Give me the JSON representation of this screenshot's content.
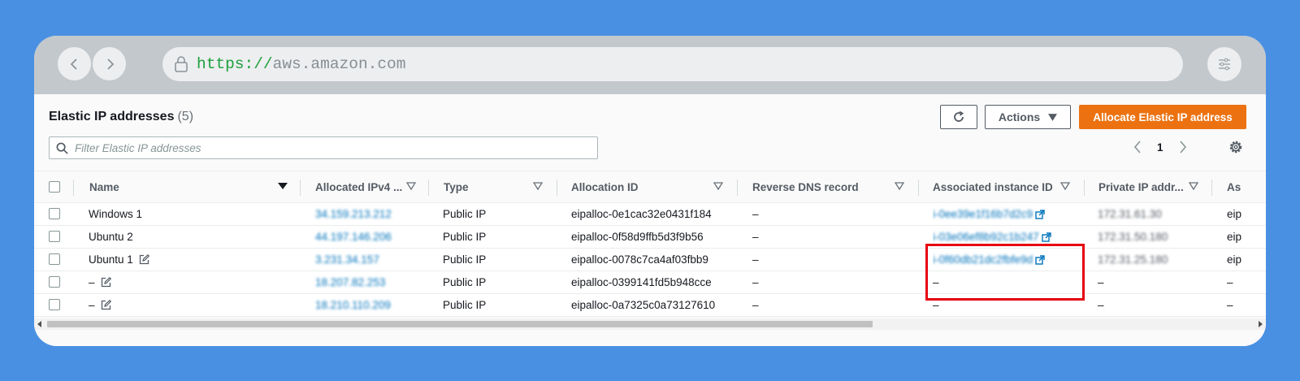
{
  "browser": {
    "url_scheme": "https://",
    "url_host": "aws.amazon.com"
  },
  "panel": {
    "title": "Elastic IP addresses",
    "count": "(5)",
    "actions_label": "Actions",
    "allocate_label": "Allocate Elastic IP address",
    "filter_placeholder": "Filter Elastic IP addresses",
    "current_page": "1"
  },
  "table": {
    "columns": [
      "Name",
      "Allocated IPv4 ...",
      "Type",
      "Allocation ID",
      "Reverse DNS record",
      "Associated instance ID",
      "Private IP addr...",
      "As"
    ],
    "rows": [
      {
        "name": "Windows 1",
        "ipv4": "34.159.213.212",
        "type": "Public IP",
        "allocation_id": "eipalloc-0e1cac32e0431f184",
        "reverse_dns": "–",
        "instance_id": "i-0ee39e1f16b7d2c9",
        "private_ip": "172.31.61.30",
        "assoc": "eip"
      },
      {
        "name": "Ubuntu 2",
        "ipv4": "44.197.146.206",
        "type": "Public IP",
        "allocation_id": "eipalloc-0f58d9ffb5d3f9b56",
        "reverse_dns": "–",
        "instance_id": "i-03e06ef8b92c1b247",
        "private_ip": "172.31.50.180",
        "assoc": "eip"
      },
      {
        "name": "Ubuntu 1",
        "ipv4": "3.231.34.157",
        "type": "Public IP",
        "allocation_id": "eipalloc-0078c7ca4af03fbb9",
        "reverse_dns": "–",
        "instance_id": "i-0f60db21dc2fbfe9d",
        "private_ip": "172.31.25.180",
        "assoc": "eip"
      },
      {
        "name": "–",
        "ipv4": "18.207.82.253",
        "type": "Public IP",
        "allocation_id": "eipalloc-0399141fd5b948cce",
        "reverse_dns": "–",
        "instance_id": "–",
        "private_ip": "–",
        "assoc": "–"
      },
      {
        "name": "–",
        "ipv4": "18.210.110.209",
        "type": "Public IP",
        "allocation_id": "eipalloc-0a7325c0a73127610",
        "reverse_dns": "–",
        "instance_id": "–",
        "private_ip": "–",
        "assoc": "–"
      }
    ]
  },
  "colors": {
    "background": "#4a90e2",
    "primary_button": "#ec7211",
    "link": "#0073bb",
    "highlight": "#e60012"
  }
}
